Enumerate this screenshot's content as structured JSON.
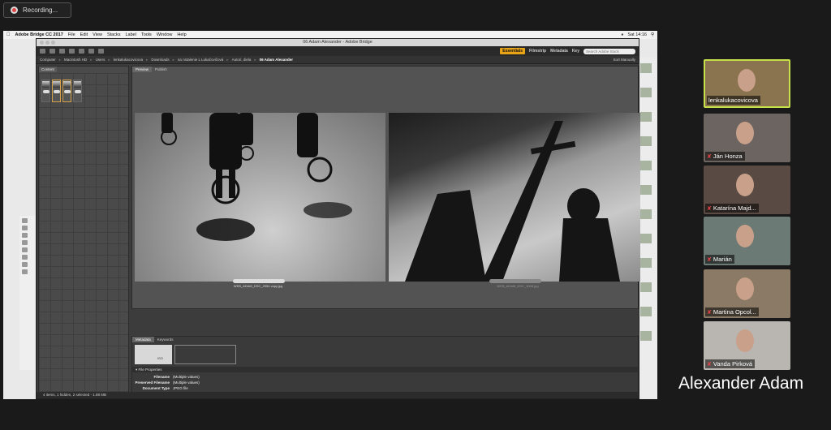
{
  "recording": {
    "label": "Recording..."
  },
  "mac_menu": {
    "app": "Adobe Bridge CC 2017",
    "items": [
      "File",
      "Edit",
      "View",
      "Stacks",
      "Label",
      "Tools",
      "Window",
      "Help"
    ],
    "clock": "Sat 14:16"
  },
  "bridge": {
    "window_title": "06 Adam Alexander - Adobe Bridge",
    "workspaces": {
      "active": "Essentials",
      "items": [
        "Filmstrip",
        "Metadata",
        "Key"
      ]
    },
    "search_placeholder": "Search Adobe Stock",
    "path": [
      "Computer",
      "Macintosh HD",
      "Users",
      "lenkalukacovicova",
      "Downloads",
      "na nstalenie L Lukačovičová",
      "Autori, diela",
      "06 Adam Alexander"
    ],
    "sort_label": "Sort Manually",
    "content_tab": "Content",
    "preview_tabs": [
      "Preview",
      "Publish"
    ],
    "photos": [
      {
        "caption": "WEB_ADAM_DSC_2954 copy.jpg"
      },
      {
        "caption": "WEB_ADAM_DSC_3008.jpg"
      }
    ],
    "metadata_tabs": [
      "Metadata",
      "Keywords"
    ],
    "placard_iso": "ISO",
    "file_properties": {
      "section": "File Properties",
      "rows": [
        {
          "key": "Filename",
          "value": "(Multiple values)"
        },
        {
          "key": "Preserved Filename",
          "value": "(Multiple values)"
        },
        {
          "key": "Document Type",
          "value": "JPEG file"
        }
      ]
    },
    "status": "4 items, 1 hidden, 2 selected - 1.88 MB"
  },
  "participants": [
    {
      "name": "lenkalukacovicova",
      "muted": false,
      "active": true,
      "bg": "#8a7450"
    },
    {
      "name": "Ján Honza",
      "muted": true,
      "active": false,
      "bg": "#6c6460"
    },
    {
      "name": "Katarína Majd...",
      "muted": true,
      "active": false,
      "bg": "#5a4a44"
    },
    {
      "name": "Marián",
      "muted": true,
      "active": false,
      "bg": "#6b7a74"
    },
    {
      "name": "Martina Opcol...",
      "muted": true,
      "active": false,
      "bg": "#8a7a66"
    },
    {
      "name": "Vanda Pirková",
      "muted": true,
      "active": false,
      "bg": "#b9b5b0"
    }
  ],
  "speaker_name": "Alexander Adam",
  "colors": {
    "accent": "#e8a317",
    "active_speaker": "#c6e04a",
    "mic_muted": "#e04444"
  }
}
